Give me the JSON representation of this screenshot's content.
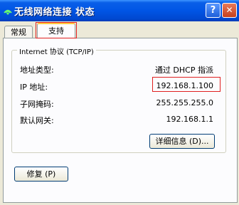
{
  "window": {
    "title": "无线网络连接 状态",
    "help_label": "?",
    "close_label": "✕"
  },
  "tabs": [
    {
      "label": "常规"
    },
    {
      "label": "支持"
    }
  ],
  "group": {
    "title": "Internet 协议 (TCP/IP)",
    "rows": [
      {
        "label": "地址类型:",
        "value": "通过 DHCP 指派"
      },
      {
        "label": "IP 地址:",
        "value": "192.168.1.100"
      },
      {
        "label": "子网掩码:",
        "value": "255.255.255.0"
      },
      {
        "label": "默认网关:",
        "value": "192.168.1.1"
      }
    ]
  },
  "buttons": {
    "details": "详细信息 (D)...",
    "repair": "修复 (P)"
  },
  "colors": {
    "highlight": "#e02020",
    "titlebar": "#0055e5"
  }
}
